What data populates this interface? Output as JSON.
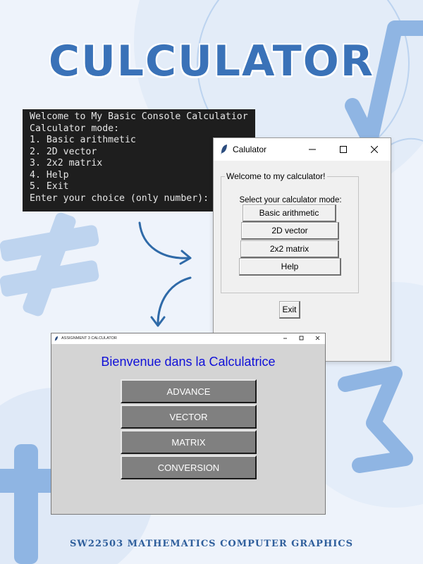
{
  "poster": {
    "title": "CULCULATOR",
    "footer": "SW22503 MATHEMATICS COMPUTER GRAPHICS",
    "accent": "#3a72b8"
  },
  "console": {
    "lines": [
      "Welcome to My Basic Console Calculatior",
      "Calculator mode:",
      "1. Basic arithmetic",
      "2. 2D vector",
      "3. 2x2 matrix",
      "4. Help",
      "5. Exit",
      "Enter your choice (only number):"
    ]
  },
  "window1": {
    "title": "Calulator",
    "group_label": "Welcome to my calculator!",
    "prompt": "Select your calculator mode:",
    "buttons": [
      "Basic arithmetic",
      "2D vector",
      "2x2 matrix",
      "Help"
    ],
    "exit_label": "Exit"
  },
  "window2": {
    "title": "ASSIGNMENT 3 CALCULATOR",
    "heading": "Bienvenue dans la Calculatrice",
    "buttons": [
      "ADVANCE",
      "VECTOR",
      "MATRIX",
      "CONVERSION"
    ]
  },
  "icons": {
    "feather": "feather-icon",
    "minimize": "minimize-icon",
    "maximize": "maximize-icon",
    "close": "close-icon",
    "arrow": "curved-arrow-icon"
  }
}
